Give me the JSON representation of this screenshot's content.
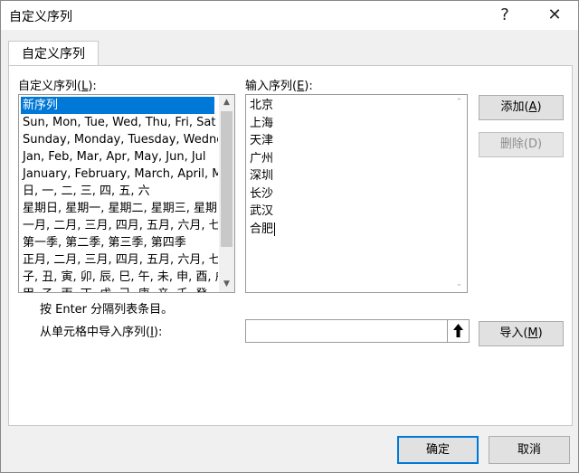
{
  "window": {
    "title": "自定义序列",
    "help_glyph": "?",
    "close_glyph": "✕"
  },
  "tab": {
    "label": "自定义序列"
  },
  "custom_lists": {
    "label_prefix": "自定义序列(",
    "label_key": "L",
    "label_suffix": "):",
    "items": [
      "新序列",
      "Sun, Mon, Tue, Wed, Thu, Fri, Sat",
      "Sunday, Monday, Tuesday, Wednesday",
      "Jan, Feb, Mar, Apr, May, Jun, Jul",
      "January, February, March, April, Ma",
      "日, 一, 二, 三, 四, 五, 六",
      "星期日, 星期一, 星期二, 星期三, 星期",
      "一月, 二月, 三月, 四月, 五月, 六月, 七",
      "第一季, 第二季, 第三季, 第四季",
      "正月, 二月, 三月, 四月, 五月, 六月, 七",
      "子, 丑, 寅, 卯, 辰, 巳, 午, 未, 申, 酉, 戌",
      "甲, 乙, 丙, 丁, 戊, 己, 庚, 辛, 壬, 癸"
    ],
    "selected_index": 0
  },
  "entries": {
    "label_prefix": "输入序列(",
    "label_key": "E",
    "label_suffix": "):",
    "lines": [
      "北京",
      "上海",
      "天津",
      "广州",
      "深圳",
      "长沙",
      "武汉",
      "合肥"
    ]
  },
  "buttons": {
    "add_prefix": "添加(",
    "add_key": "A",
    "add_suffix": ")",
    "delete_label": "删除(D)",
    "import_prefix": "导入(",
    "import_key": "M",
    "import_suffix": ")",
    "ok_label": "确定",
    "cancel_label": "取消"
  },
  "hint": "按 Enter 分隔列表条目。",
  "import_from_cells": {
    "label_prefix": "从单元格中导入序列(",
    "label_key": "I",
    "label_suffix": "):",
    "value": "",
    "collapse_glyph": "🡅"
  },
  "colors": {
    "selection": "#0078d7",
    "dialog_bg": "#f0f0f0",
    "panel_bg": "#ffffff"
  }
}
